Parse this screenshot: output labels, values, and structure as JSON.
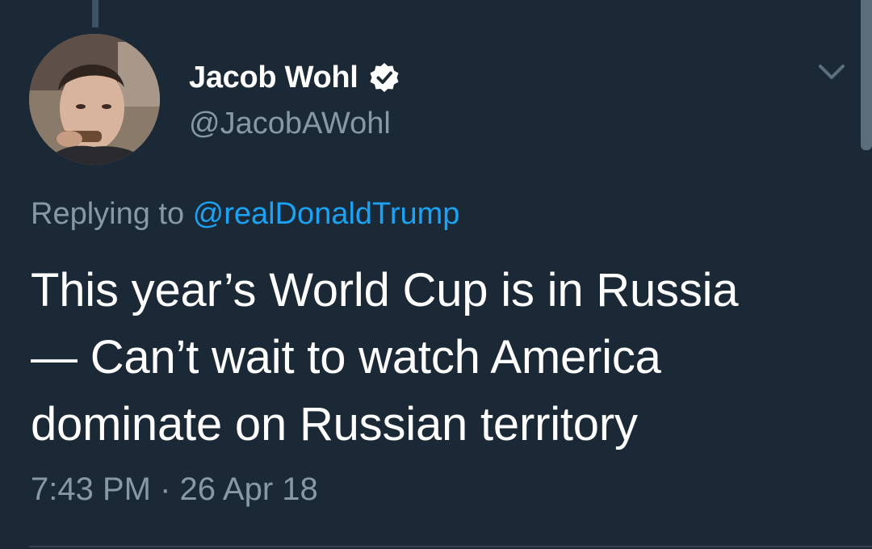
{
  "author": {
    "display_name": "Jacob Wohl",
    "handle": "@JacobAWohl",
    "verified_icon": "verified-badge-icon"
  },
  "reply": {
    "prefix": "Replying to ",
    "mention": "@realDonaldTrump"
  },
  "tweet": {
    "lines": [
      "This year’s World Cup is in Russia",
      "— Can’t wait to watch America",
      "dominate on Russian territory"
    ],
    "time": "7:43 PM",
    "separator": " · ",
    "date": "26 Apr 18"
  },
  "colors": {
    "background": "#1b2836",
    "text": "#ffffff",
    "secondary": "#8899a6",
    "link": "#1da1f2"
  }
}
